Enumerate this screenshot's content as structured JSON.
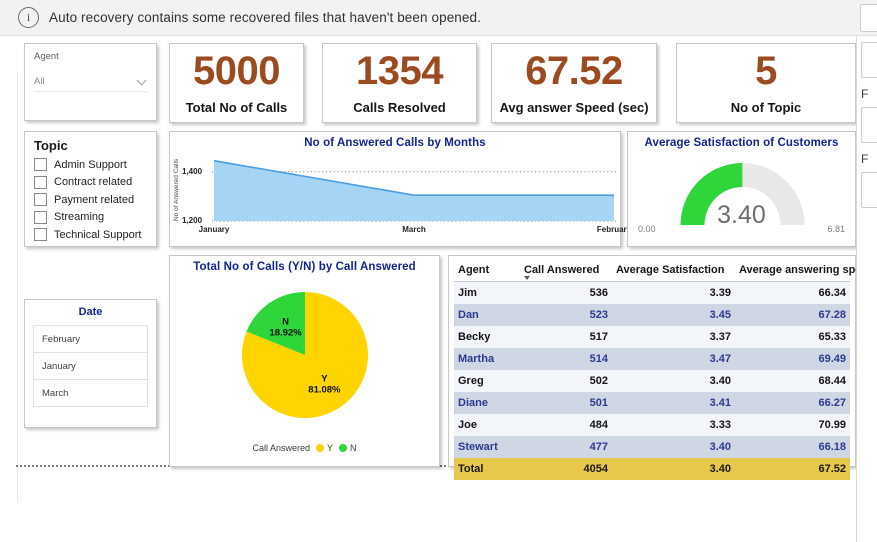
{
  "notification": {
    "icon": "info-circle-icon",
    "message": "Auto recovery contains some recovered files that haven't been opened."
  },
  "slicers": {
    "agent": {
      "label": "Agent",
      "value": "All",
      "chevron_icon": "chevron-down-icon"
    },
    "topic": {
      "title": "Topic",
      "items": [
        {
          "label": "Admin Support",
          "checked": false
        },
        {
          "label": "Contract related",
          "checked": false
        },
        {
          "label": "Payment related",
          "checked": false
        },
        {
          "label": "Streaming",
          "checked": false
        },
        {
          "label": "Technical Support",
          "checked": false
        }
      ]
    },
    "date": {
      "title": "Date",
      "items": [
        "February",
        "January",
        "March"
      ]
    }
  },
  "kpis": [
    {
      "value": "5000",
      "label": "Total No of Calls"
    },
    {
      "value": "1354",
      "label": "Calls Resolved"
    },
    {
      "value": "67.52",
      "label": "Avg answer Speed (sec)"
    },
    {
      "value": "5",
      "label": "No of Topic"
    }
  ],
  "colors": {
    "kpi_value": "#9c4a20",
    "title_blue": "#13238f",
    "area_fill": "#a6d4f5",
    "area_line": "#4a9fe0",
    "pie_yes": "#ffd400",
    "pie_no": "#2fd63a",
    "gauge_fill": "#2fd63a",
    "gauge_track": "#e8e8e8",
    "total_row": "#e8c84a",
    "alt_row": "#cfd6e4"
  },
  "chart_data": [
    {
      "type": "area",
      "title": "No of Answered Calls by Months",
      "xlabel": "",
      "ylabel": "No of Answered Calls",
      "categories": [
        "January",
        "March",
        "February"
      ],
      "values": [
        1445,
        1305,
        1305
      ],
      "yticks": [
        "1,200",
        "1,400"
      ],
      "ylim": [
        1200,
        1460
      ],
      "grid": true,
      "legend": "none"
    },
    {
      "type": "gauge",
      "title": "Average Satisfaction of Customers",
      "value": "3.40",
      "value_num": 3.4,
      "min_label": "0.00",
      "max_label": "6.81",
      "min": 0,
      "max": 6.81
    },
    {
      "type": "pie",
      "title": "Total No of Calls (Y/N) by Call Answered",
      "legend_title": "Call Answered",
      "legend_position": "bottom",
      "categories": [
        "Y",
        "N"
      ],
      "values": [
        81.08,
        18.92
      ],
      "labels": [
        "81.08%",
        "18.92%"
      ]
    },
    {
      "type": "table",
      "columns": [
        "Agent",
        "Call Answered",
        "Average Satisfaction",
        "Average answering speed (S)"
      ],
      "sorted_column": "Call Answered",
      "sort_icon": "sort-descending-icon",
      "rows": [
        {
          "agent": "Jim",
          "answered": "536",
          "satisfaction": "3.39",
          "speed": "66.34"
        },
        {
          "agent": "Dan",
          "answered": "523",
          "satisfaction": "3.45",
          "speed": "67.28"
        },
        {
          "agent": "Becky",
          "answered": "517",
          "satisfaction": "3.37",
          "speed": "65.33"
        },
        {
          "agent": "Martha",
          "answered": "514",
          "satisfaction": "3.47",
          "speed": "69.49"
        },
        {
          "agent": "Greg",
          "answered": "502",
          "satisfaction": "3.40",
          "speed": "68.44"
        },
        {
          "agent": "Diane",
          "answered": "501",
          "satisfaction": "3.41",
          "speed": "66.27"
        },
        {
          "agent": "Joe",
          "answered": "484",
          "satisfaction": "3.33",
          "speed": "70.99"
        },
        {
          "agent": "Stewart",
          "answered": "477",
          "satisfaction": "3.40",
          "speed": "66.18"
        }
      ],
      "total": {
        "agent": "Total",
        "answered": "4054",
        "satisfaction": "3.40",
        "speed": "67.52"
      }
    }
  ],
  "right_pane": {
    "section_labels": [
      "F",
      "F"
    ]
  }
}
